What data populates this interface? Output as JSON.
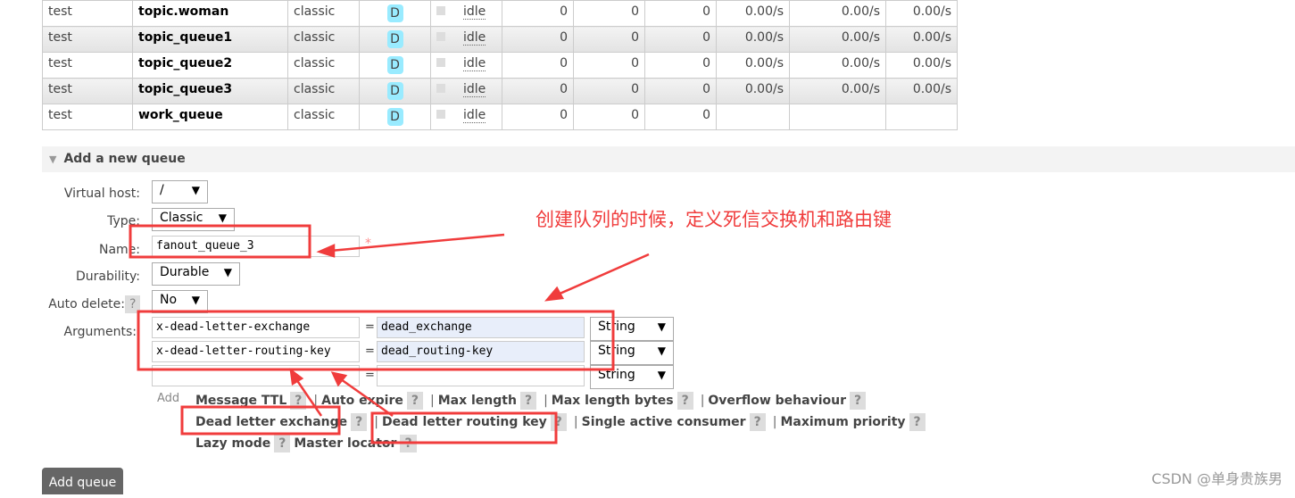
{
  "queues": [
    {
      "vhost": "test",
      "name": "topic.woman",
      "type": "classic",
      "feature": "D",
      "state": "idle",
      "ready": "0",
      "unacked": "0",
      "total": "0",
      "in": "0.00/s",
      "deliver": "0.00/s",
      "ack": "0.00/s"
    },
    {
      "vhost": "test",
      "name": "topic_queue1",
      "type": "classic",
      "feature": "D",
      "state": "idle",
      "ready": "0",
      "unacked": "0",
      "total": "0",
      "in": "0.00/s",
      "deliver": "0.00/s",
      "ack": "0.00/s"
    },
    {
      "vhost": "test",
      "name": "topic_queue2",
      "type": "classic",
      "feature": "D",
      "state": "idle",
      "ready": "0",
      "unacked": "0",
      "total": "0",
      "in": "0.00/s",
      "deliver": "0.00/s",
      "ack": "0.00/s"
    },
    {
      "vhost": "test",
      "name": "topic_queue3",
      "type": "classic",
      "feature": "D",
      "state": "idle",
      "ready": "0",
      "unacked": "0",
      "total": "0",
      "in": "0.00/s",
      "deliver": "0.00/s",
      "ack": "0.00/s"
    },
    {
      "vhost": "test",
      "name": "work_queue",
      "type": "classic",
      "feature": "D",
      "state": "idle",
      "ready": "0",
      "unacked": "0",
      "total": "0",
      "in": "",
      "deliver": "",
      "ack": ""
    }
  ],
  "form": {
    "section_title": "Add a new queue",
    "vhost_label": "Virtual host:",
    "vhost_value": "/",
    "type_label": "Type:",
    "type_value": "Classic",
    "name_label": "Name:",
    "name_value": "fanout_queue_3",
    "required": "*",
    "durability_label": "Durability:",
    "durability_value": "Durable",
    "autodelete_label": "Auto delete:",
    "autodelete_value": "No",
    "arguments_label": "Arguments:",
    "arguments": [
      {
        "key": "x-dead-letter-exchange",
        "value": "dead_exchange",
        "type": "String"
      },
      {
        "key": "x-dead-letter-routing-key",
        "value": "dead_routing-key",
        "type": "String"
      },
      {
        "key": "",
        "value": "",
        "type": "String"
      }
    ],
    "equals": "=",
    "add_label": "Add",
    "help": "?",
    "sep": "|",
    "shortcuts": [
      "Message TTL",
      "Auto expire",
      "Max length",
      "Max length bytes",
      "Overflow behaviour",
      "Dead letter exchange",
      "Dead letter routing key",
      "Single active consumer",
      "Maximum priority",
      "Lazy mode",
      "Master locator"
    ],
    "submit": "Add queue"
  },
  "annotation": {
    "text": "创建队列的时候，定义死信交换机和路由键",
    "color": "#f03c3c"
  },
  "watermark": "CSDN @单身贵族男"
}
